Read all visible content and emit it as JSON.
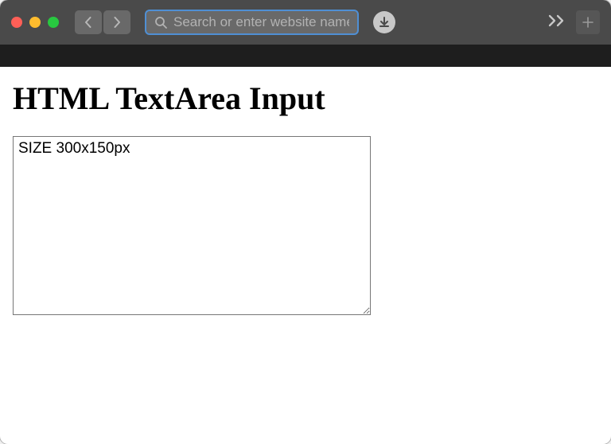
{
  "browser": {
    "search_placeholder": "Search or enter website name"
  },
  "page": {
    "heading": "HTML TextArea Input",
    "textarea_value": "SIZE 300x150px"
  }
}
